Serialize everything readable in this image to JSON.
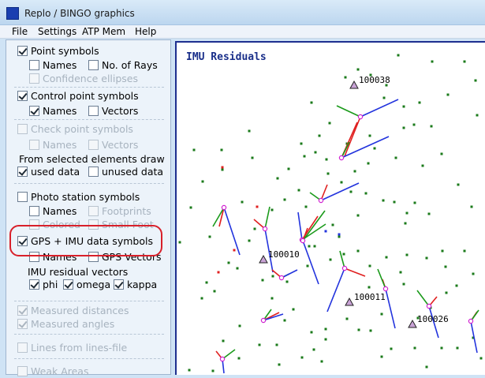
{
  "window": {
    "title": "Replo / BINGO graphics"
  },
  "menu": [
    "File",
    "Settings",
    "ATP Mem",
    "Help"
  ],
  "sidebar": {
    "point_symbols": {
      "label": "Point symbols",
      "checked": true
    },
    "names1": {
      "label": "Names",
      "checked": false
    },
    "no_of_rays": {
      "label": "No. of Rays",
      "checked": false
    },
    "confidence_ellipses": {
      "label": "Confidence ellipses",
      "checked": false
    },
    "control_point_symbols": {
      "label": "Control point symbols",
      "checked": true
    },
    "names2": {
      "label": "Names",
      "checked": true
    },
    "vectors2": {
      "label": "Vectors",
      "checked": false
    },
    "check_point_symbols": {
      "label": "Check point symbols",
      "checked": false
    },
    "names3": {
      "label": "Names",
      "checked": false
    },
    "vectors3": {
      "label": "Vectors",
      "checked": false
    },
    "from_selected": "From selected elements draw",
    "used_data": {
      "label": "used data",
      "checked": true
    },
    "unused_data": {
      "label": "unused data",
      "checked": false
    },
    "photo_station_symbols": {
      "label": "Photo station symbols",
      "checked": false
    },
    "names4": {
      "label": "Names",
      "checked": false
    },
    "footprints": {
      "label": "Footprints",
      "checked": false
    },
    "colored": {
      "label": "Colored",
      "checked": false
    },
    "small_foot": {
      "label": "Small Foot",
      "checked": false
    },
    "gps_imu": {
      "label": "GPS + IMU data symbols",
      "checked": true
    },
    "names5": {
      "label": "Names",
      "checked": false
    },
    "gps_vectors": {
      "label": "GPS Vectors",
      "checked": false
    },
    "imu_residual_vectors": "IMU residual vectors",
    "phi": {
      "label": "phi",
      "checked": true
    },
    "omega": {
      "label": "omega",
      "checked": true
    },
    "kappa": {
      "label": "kappa",
      "checked": true
    },
    "measured_distances": {
      "label": "Measured distances",
      "checked": true
    },
    "measured_angles": {
      "label": "Measured angles",
      "checked": true
    },
    "lines_from_file": {
      "label": "Lines from lines-file",
      "checked": false
    },
    "weak_areas": {
      "label": "Weak Areas",
      "checked": false
    }
  },
  "plot": {
    "title": "IMU Residuals",
    "colors": {
      "phi": "#e02020",
      "omega": "#1a9a1a",
      "kappa": "#2233dd",
      "point": "#1a7a1a",
      "station": "#d020d0"
    },
    "control_points": [
      {
        "label": "100038"
      },
      {
        "label": "100010"
      },
      {
        "label": "100011"
      },
      {
        "label": "100026"
      }
    ]
  }
}
